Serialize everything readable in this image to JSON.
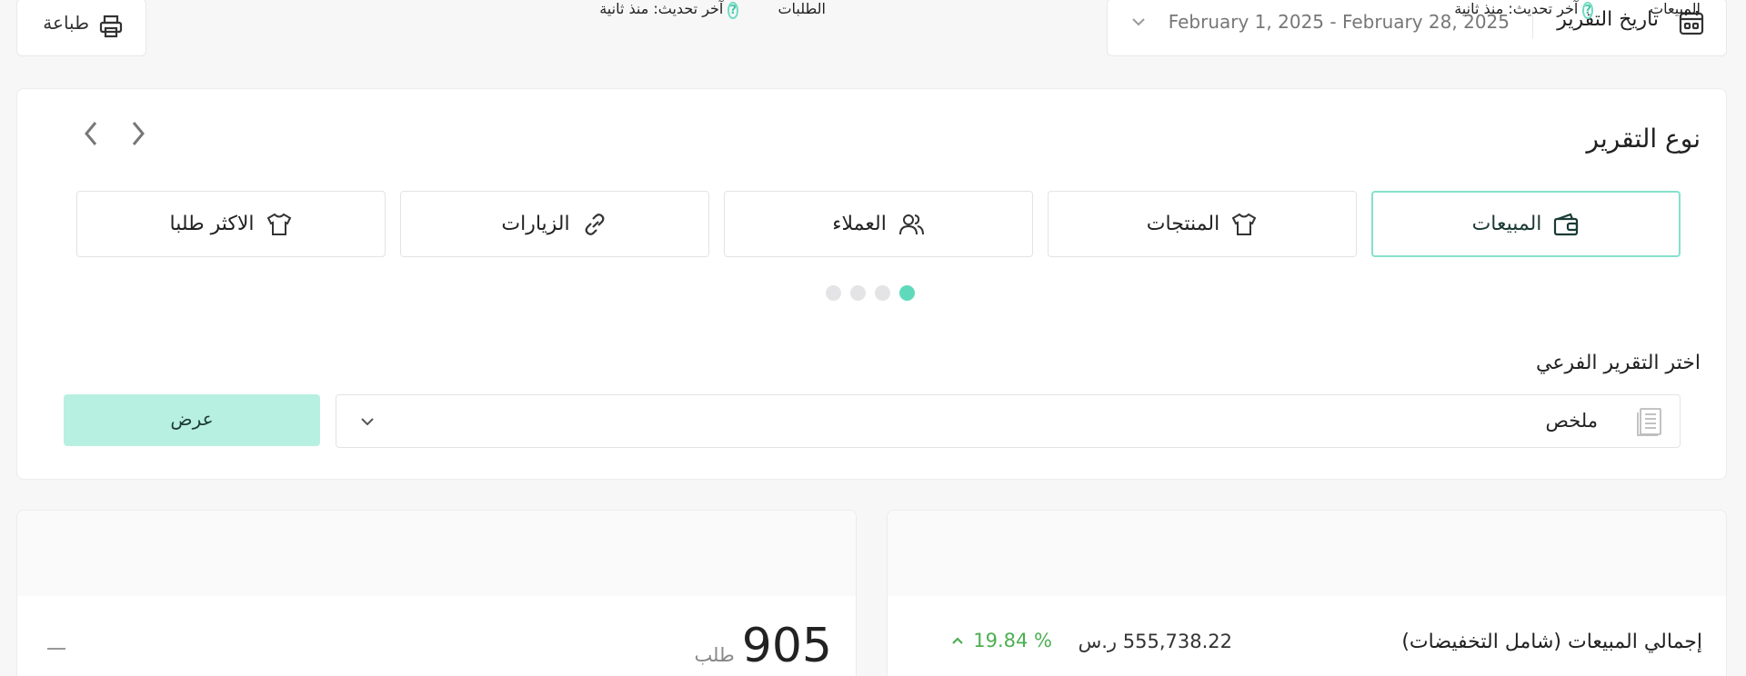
{
  "header": {
    "report_date_label": "تاريخ التقرير",
    "date_range": "February 1, 2025 - February 28, 2025",
    "print_label": "طباعة"
  },
  "report_type": {
    "title": "نوع التقرير",
    "tabs": [
      {
        "label": "المبيعات",
        "icon": "wallet-icon",
        "active": true
      },
      {
        "label": "المنتجات",
        "icon": "tshirt-icon",
        "active": false
      },
      {
        "label": "العملاء",
        "icon": "users-icon",
        "active": false
      },
      {
        "label": "الزيارات",
        "icon": "link-icon",
        "active": false
      },
      {
        "label": "الاكثر طلبا",
        "icon": "tshirt-icon",
        "active": false
      }
    ],
    "pagination": {
      "pages": 4,
      "current": 1
    }
  },
  "sub_report": {
    "label": "اختر التقرير الفرعي",
    "selected": "ملخص",
    "show_button": "عرض"
  },
  "sales_card": {
    "title": "المبيعات",
    "updated": "آخر تحديث: منذ ثانية",
    "row": {
      "label": "إجمالي المبيعات (شامل التخفيضات)",
      "amount": "555,738.22 ر.س",
      "change": "19.84 %",
      "trend": "up"
    }
  },
  "orders_card": {
    "title": "الطلبات",
    "updated": "آخر تحديث: منذ ثانية",
    "count": "905",
    "unit": "طلب"
  },
  "colors": {
    "accent": "#5fd9bc",
    "button_bg": "#b7f0e1",
    "positive": "#4caf50"
  }
}
